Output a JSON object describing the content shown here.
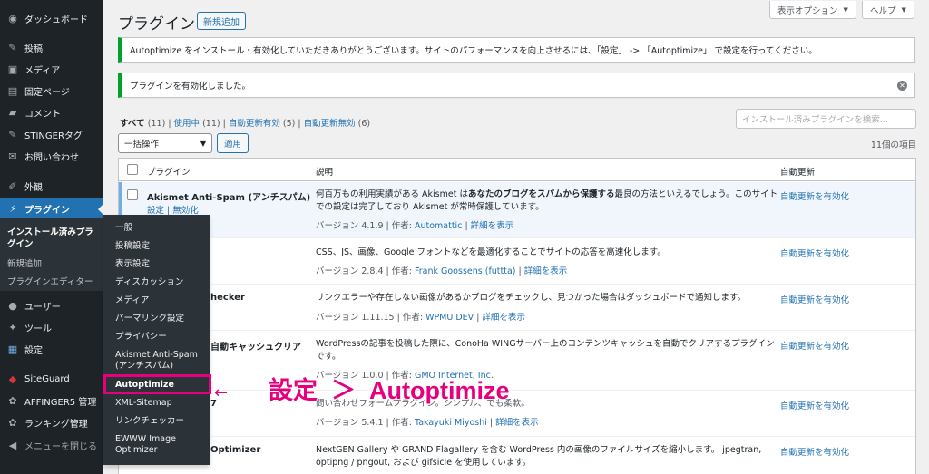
{
  "sidebar": {
    "items": [
      {
        "icon": "dashboard-icon",
        "glyph": "◉",
        "label": "ダッシュボード"
      },
      {
        "icon": "pin-icon",
        "glyph": "✎",
        "label": "投稿"
      },
      {
        "icon": "media-icon",
        "glyph": "▣",
        "label": "メディア"
      },
      {
        "icon": "page-icon",
        "glyph": "▤",
        "label": "固定ページ"
      },
      {
        "icon": "comment-icon",
        "glyph": "▰",
        "label": "コメント"
      },
      {
        "icon": "pin-icon",
        "glyph": "✎",
        "label": "STINGERタグ"
      },
      {
        "icon": "mail-icon",
        "glyph": "✉",
        "label": "お問い合わせ"
      },
      {
        "icon": "brush-icon",
        "glyph": "✐",
        "label": "外観"
      },
      {
        "icon": "plugin-icon",
        "glyph": "⚡",
        "label": "プラグイン"
      },
      {
        "icon": "user-icon",
        "glyph": "●",
        "label": "ユーザー"
      },
      {
        "icon": "wrench-icon",
        "glyph": "✦",
        "label": "ツール"
      },
      {
        "icon": "settings-icon",
        "glyph": "▦",
        "label": "設定"
      },
      {
        "icon": "shield-icon",
        "glyph": "◆",
        "label": "SiteGuard"
      },
      {
        "icon": "gear-icon",
        "glyph": "✿",
        "label": "AFFINGER5 管理"
      },
      {
        "icon": "gear-icon",
        "glyph": "✿",
        "label": "ランキング管理"
      },
      {
        "icon": "collapse-icon",
        "glyph": "◀",
        "label": "メニューを閉じる"
      }
    ],
    "submenu": [
      "インストール済みプラグイン",
      "新規追加",
      "プラグインエディター"
    ]
  },
  "flyout": {
    "items": [
      "一般",
      "投稿設定",
      "表示設定",
      "ディスカッション",
      "メディア",
      "パーマリンク設定",
      "プライバシー",
      "Akismet Anti-Spam (アンチスパム)",
      "Autoptimize",
      "XML-Sitemap",
      "リンクチェッカー",
      "EWWW Image Optimizer"
    ]
  },
  "header": {
    "title": "プラグイン",
    "add_new": "新規追加",
    "screen_options": "表示オプション",
    "help": "ヘルプ"
  },
  "notices": {
    "autoptimize": "Autoptimize をインストール・有効化していただきありがとうございます。サイトのパフォーマンスを向上させるには、「設定」 -> 「Autoptimize」 で設定を行ってください。",
    "activated": "プラグインを有効化しました。"
  },
  "filters": {
    "all": "すべて",
    "all_count": "(11)",
    "active": "使用中",
    "active_count": "(11)",
    "auto_on": "自動更新有効",
    "auto_on_count": "(5)",
    "auto_off": "自動更新無効",
    "auto_off_count": "(6)"
  },
  "search": {
    "placeholder": "インストール済みプラグインを検索..."
  },
  "bulk": {
    "select": "一括操作",
    "apply": "適用",
    "count": "11個の項目"
  },
  "table": {
    "headers": {
      "plugin": "プラグイン",
      "description": "説明",
      "auto_update": "自動更新"
    },
    "rows": [
      {
        "name": "Akismet Anti-Spam (アンチスパム)",
        "actions": "設定 | 無効化",
        "desc_pre": "何百万もの利用実績がある Akismet は",
        "desc_bold": "あなたのブログをスパムから保護する",
        "desc_post": "最良の方法といえるでしょう。このサイトでの設定は完了しており Akismet が常時保護しています。",
        "version": "バージョン 4.1.9 | 作者: ",
        "author": "Automattic",
        "details": "詳細を表示",
        "auto": "自動更新を有効化"
      },
      {
        "name": "",
        "desc": "CSS、JS、画像、Google フォントなどを最適化することでサイトの応答を高速化します。",
        "version": "バージョン 2.8.4 | 作者: ",
        "author": "Frank Goossens (futtta)",
        "details": "詳細を表示",
        "auto": "自動更新を有効化"
      },
      {
        "name": "hecker",
        "desc": "リンクエラーや存在しない画像があるかブログをチェックし、見つかった場合はダッシュボードで通知します。",
        "version": "バージョン 1.11.15 | 作者: ",
        "author": "WPMU DEV",
        "details": "詳細を表示",
        "auto": "自動更新を有効化"
      },
      {
        "name": "自動キャッシュクリア",
        "desc": "WordPressの記事を投稿した際に、ConoHa WINGサーバー上のコンテンツキャッシュを自動でクリアするプラグインです。",
        "version": "バージョン 1.0.0 | 作者: ",
        "author": "GMO Internet, Inc.",
        "details": "",
        "auto": "自動更新を有効化"
      },
      {
        "name": "7",
        "desc": "問い合わせフォームプラグイン。シンプル、でも柔軟。",
        "version": "バージョン 5.4.1 | 作者: ",
        "author": "Takayuki Miyoshi",
        "details": "詳細を表示",
        "auto": "自動更新を有効化"
      },
      {
        "name": "Optimizer",
        "desc": "NextGEN Gallery や GRAND Flagallery を含む WordPress 内の画像のファイルサイズを縮小します。 jpegtran, optipng / pngout, および gifsicle を使用しています。",
        "version": "",
        "author": "",
        "details": "",
        "auto": "自動更新を有効化"
      }
    ]
  },
  "annotation": {
    "arrow": "←",
    "text": "設定  ＞  Autoptimize",
    "color": "#e6007e"
  }
}
